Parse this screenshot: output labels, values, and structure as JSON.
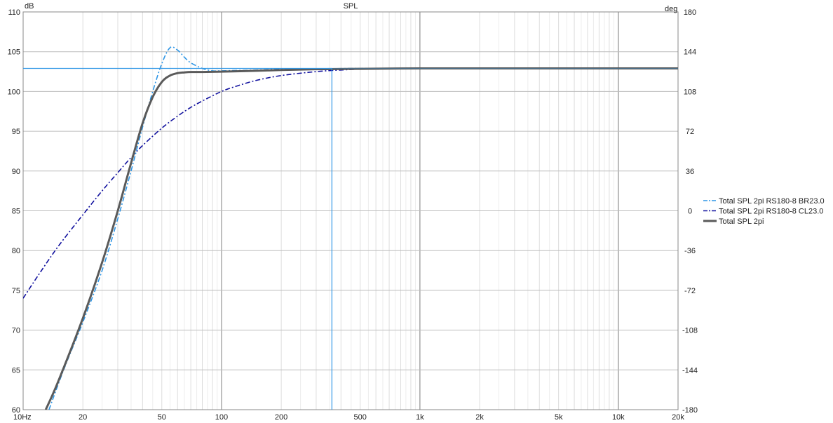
{
  "chart_data": {
    "type": "line",
    "title": "SPL",
    "xscale": "log",
    "xlim": [
      10,
      20000
    ],
    "ylim": [
      60,
      110
    ],
    "y2lim": [
      -180,
      180
    ],
    "ylabel": "dB",
    "y2label": "deg",
    "xticks": [
      {
        "v": 10,
        "label": "10Hz"
      },
      {
        "v": 20,
        "label": "20"
      },
      {
        "v": 50,
        "label": "50"
      },
      {
        "v": 100,
        "label": "100"
      },
      {
        "v": 200,
        "label": "200"
      },
      {
        "v": 500,
        "label": "500"
      },
      {
        "v": 1000,
        "label": "1k"
      },
      {
        "v": 2000,
        "label": "2k"
      },
      {
        "v": 5000,
        "label": "5k"
      },
      {
        "v": 10000,
        "label": "10k"
      },
      {
        "v": 20000,
        "label": "20k"
      }
    ],
    "yticks": [
      {
        "v": 60,
        "label": "60"
      },
      {
        "v": 65,
        "label": "65"
      },
      {
        "v": 70,
        "label": "70"
      },
      {
        "v": 75,
        "label": "75"
      },
      {
        "v": 80,
        "label": "80"
      },
      {
        "v": 85,
        "label": "85"
      },
      {
        "v": 90,
        "label": "90"
      },
      {
        "v": 95,
        "label": "95"
      },
      {
        "v": 100,
        "label": "100"
      },
      {
        "v": 105,
        "label": "105"
      },
      {
        "v": 110,
        "label": "110"
      }
    ],
    "y2ticks": [
      {
        "v": 180,
        "label": "180"
      },
      {
        "v": 144,
        "label": "144"
      },
      {
        "v": 108,
        "label": "108"
      },
      {
        "v": 72,
        "label": "72"
      },
      {
        "v": 36,
        "label": "36"
      },
      {
        "v": 0,
        "label": "0"
      },
      {
        "v": -36,
        "label": "-36"
      },
      {
        "v": -72,
        "label": "-72"
      },
      {
        "v": -108,
        "label": "-108"
      },
      {
        "v": -144,
        "label": "-144"
      },
      {
        "v": -180,
        "label": "-180"
      }
    ],
    "grid": true,
    "legend": "right",
    "cursor": {
      "x": 360,
      "y": 102.9,
      "color": "#3399e6"
    },
    "series": [
      {
        "name": "Total SPL 2pi RS180-8 BR23.0",
        "color": "#2e96e6",
        "dash": "dashdot",
        "x": [
          13.5,
          16,
          20,
          25,
          30,
          35,
          40,
          45,
          50,
          55,
          60,
          65,
          70,
          80,
          90,
          100,
          150,
          200,
          300,
          500,
          1000,
          2000,
          5000,
          10000,
          20000
        ],
        "y": [
          60,
          65,
          71,
          77.5,
          84,
          90,
          95.5,
          100,
          103.5,
          105.5,
          105.2,
          104.3,
          103.6,
          102.9,
          102.6,
          102.6,
          102.7,
          102.8,
          102.85,
          102.9,
          102.9,
          102.9,
          102.9,
          102.9,
          102.9
        ]
      },
      {
        "name": "Total SPL 2pi RS180-8 CL23.0",
        "color": "#10109e",
        "dash": "dashdot",
        "x": [
          10,
          12,
          15,
          20,
          25,
          30,
          35,
          40,
          50,
          60,
          70,
          80,
          100,
          120,
          150,
          200,
          300,
          400,
          500,
          700,
          1000,
          2000,
          5000,
          10000,
          20000
        ],
        "y": [
          74,
          77,
          80.5,
          84.5,
          87.5,
          89.8,
          91.7,
          93.2,
          95.4,
          96.9,
          98,
          98.8,
          100,
          100.7,
          101.4,
          102,
          102.5,
          102.7,
          102.8,
          102.85,
          102.9,
          102.9,
          102.9,
          102.9,
          102.9
        ]
      },
      {
        "name": "Total SPL 2pi",
        "color": "#5a5a5a",
        "dash": "solid",
        "x": [
          13,
          15,
          20,
          25,
          30,
          35,
          40,
          45,
          50,
          55,
          60,
          65,
          70,
          80,
          100,
          150,
          200,
          300,
          500,
          1000,
          2000,
          5000,
          10000,
          20000
        ],
        "y": [
          60,
          63.5,
          71.5,
          78.5,
          85,
          91,
          96,
          99.3,
          101.2,
          102,
          102.3,
          102.4,
          102.45,
          102.45,
          102.5,
          102.6,
          102.7,
          102.8,
          102.85,
          102.9,
          102.9,
          102.9,
          102.9,
          102.9
        ]
      }
    ]
  }
}
